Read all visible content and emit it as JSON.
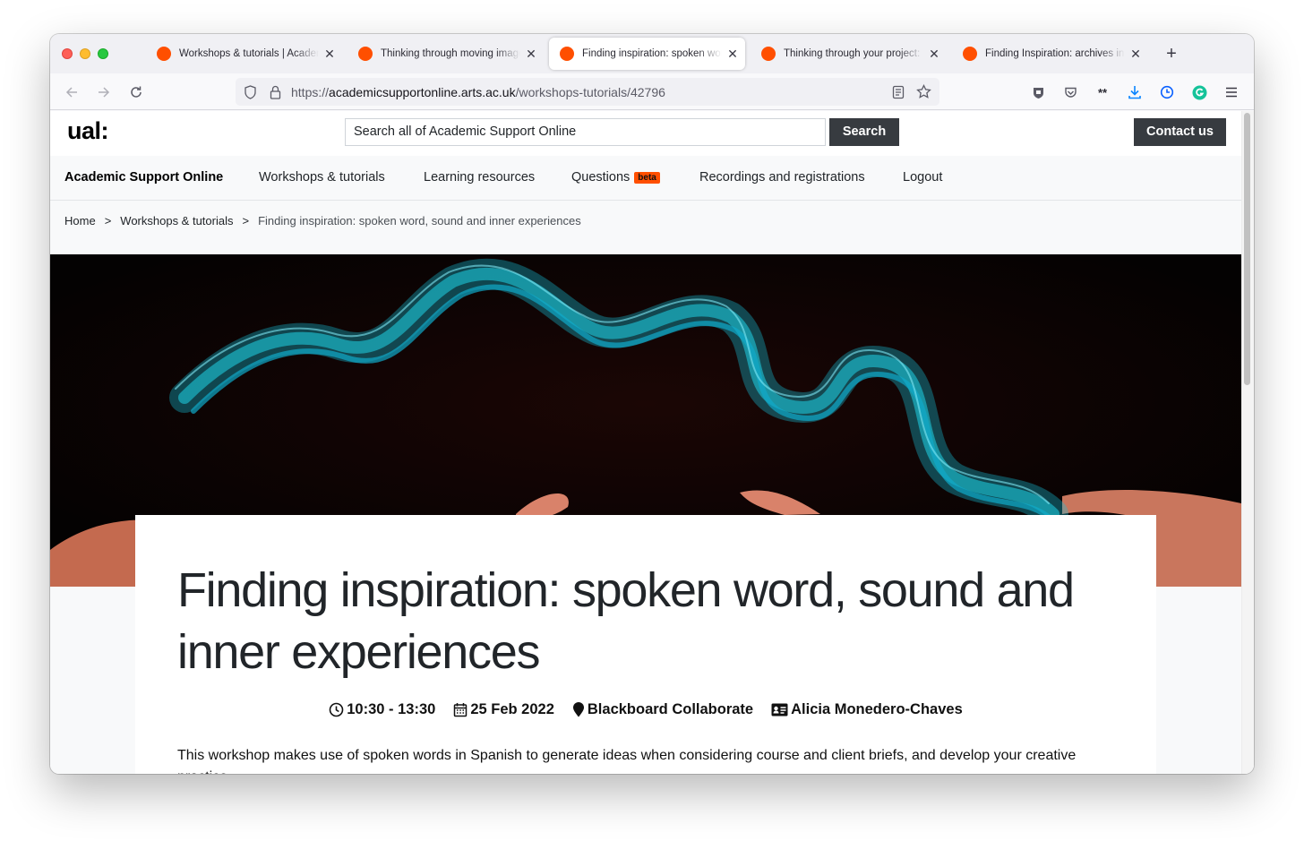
{
  "browser": {
    "tabs": [
      {
        "label": "Workshops & tutorials | Academ"
      },
      {
        "label": "Thinking through moving image"
      },
      {
        "label": "Finding inspiration: spoken word"
      },
      {
        "label": "Thinking through your project: v"
      },
      {
        "label": "Finding Inspiration: archives in c"
      }
    ],
    "url_prefix": "https://",
    "url_host": "academicsupportonline.arts.ac.uk",
    "url_path": "/workshops-tutorials/42796"
  },
  "header": {
    "logo": "ual:",
    "search_placeholder": "Search all of Academic Support Online",
    "search_button": "Search",
    "contact_button": "Contact us"
  },
  "nav": {
    "brand": "Academic Support Online",
    "items": [
      "Workshops & tutorials",
      "Learning resources",
      "Questions",
      "Recordings and registrations",
      "Logout"
    ],
    "beta_badge": "beta"
  },
  "breadcrumb": {
    "home": "Home",
    "section": "Workshops & tutorials",
    "current": "Finding inspiration: spoken word, sound and inner experiences",
    "separator": ">"
  },
  "workshop": {
    "title": "Finding inspiration: spoken word, sound and inner experiences",
    "time": "10:30 - 13:30",
    "date": "25 Feb 2022",
    "location": "Blackboard Collaborate",
    "tutor": "Alicia Monedero-Chaves",
    "description": "This workshop makes use of spoken words in Spanish to generate ideas when considering course and client briefs, and develop your creative practice."
  },
  "colors": {
    "brand_orange": "#ff4f00",
    "button_dark": "#373b40",
    "hero_cyan": "#17c6e0"
  }
}
